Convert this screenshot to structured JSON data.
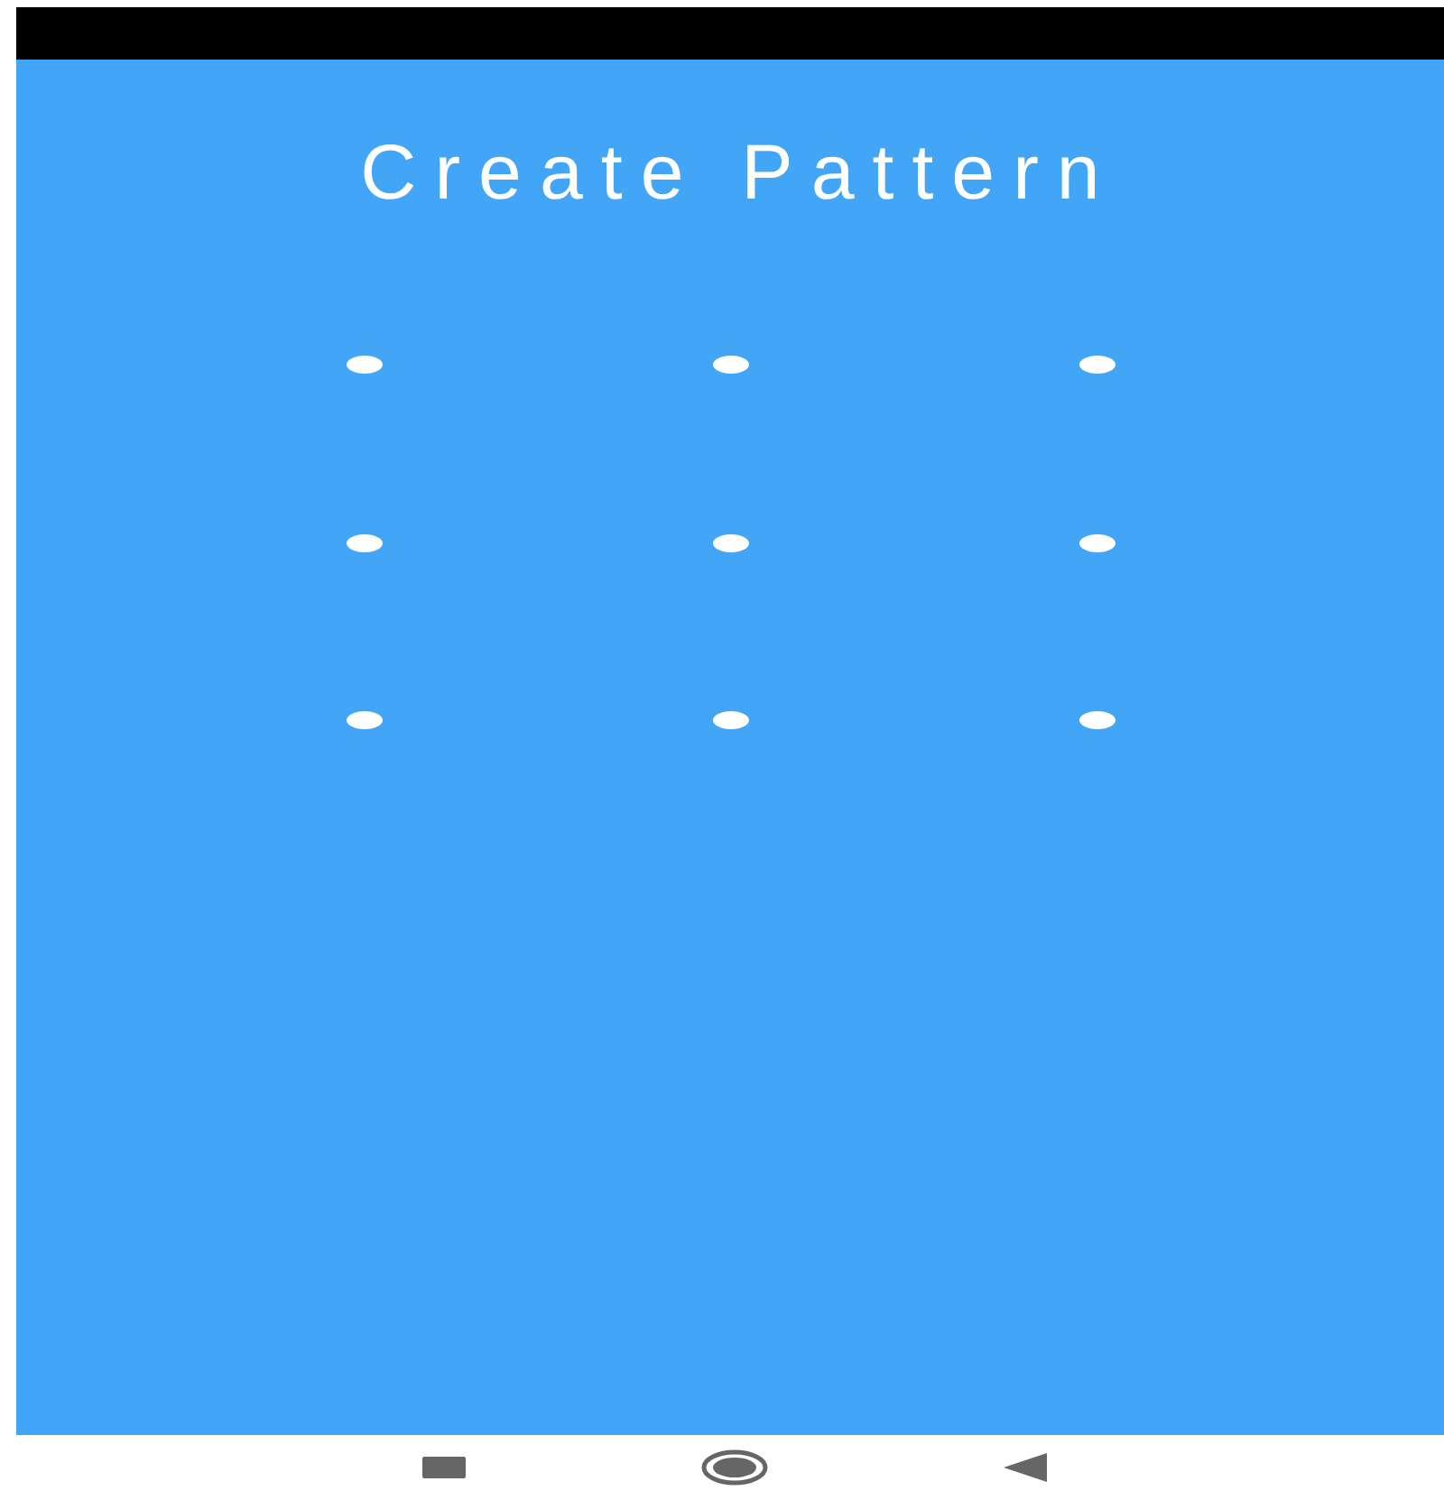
{
  "title": "Create Pattern",
  "dots": [
    {
      "selected": false
    },
    {
      "selected": false
    },
    {
      "selected": false
    },
    {
      "selected": false
    },
    {
      "selected": false
    },
    {
      "selected": false
    },
    {
      "selected": false
    },
    {
      "selected": false
    },
    {
      "selected": false
    }
  ],
  "nav_buttons": [
    {
      "kind": "recents"
    },
    {
      "kind": "home"
    },
    {
      "kind": "back"
    }
  ]
}
